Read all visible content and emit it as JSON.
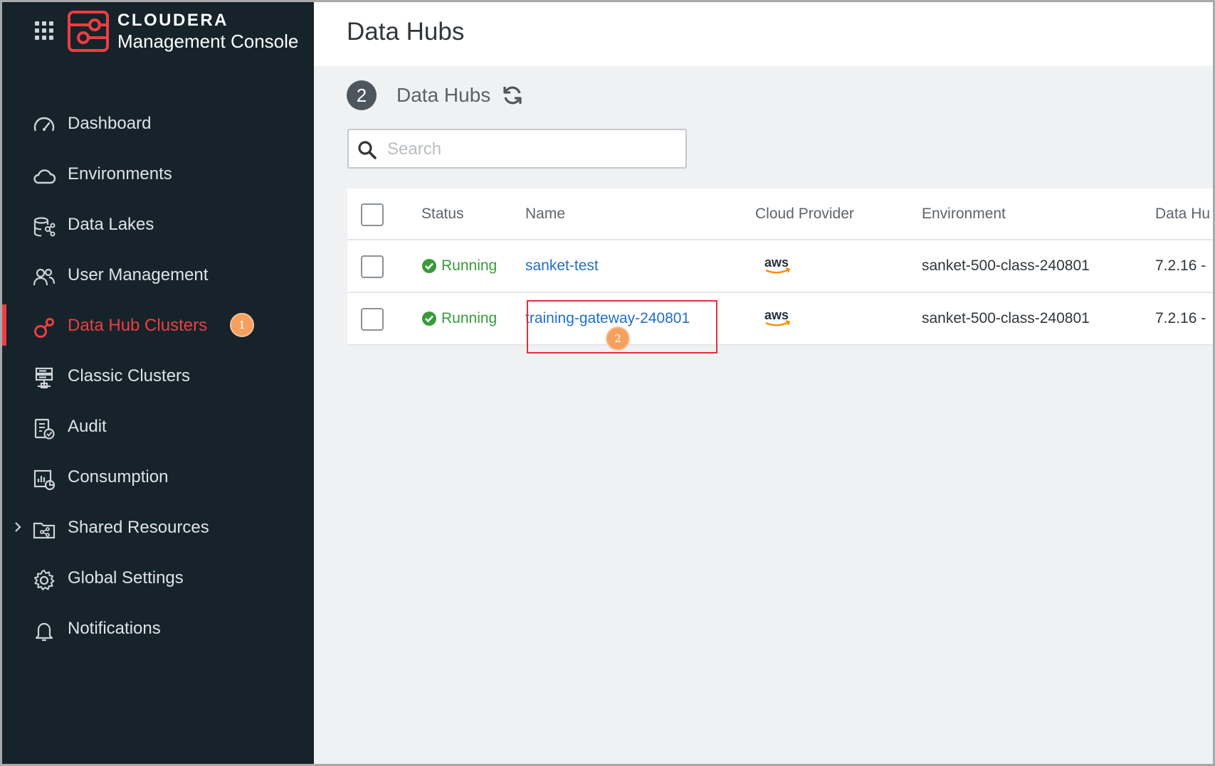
{
  "brand": {
    "name": "CLOUDERA",
    "subtitle": "Management Console",
    "accent": "#ef3e42"
  },
  "sidebar": {
    "items": [
      {
        "label": "Dashboard",
        "icon": "dashboard-gauge-icon"
      },
      {
        "label": "Environments",
        "icon": "cloud-icon"
      },
      {
        "label": "Data Lakes",
        "icon": "data-lake-icon"
      },
      {
        "label": "User Management",
        "icon": "users-icon"
      },
      {
        "label": "Data Hub Clusters",
        "icon": "data-hub-icon",
        "active": true,
        "badge": "1"
      },
      {
        "label": "Classic Clusters",
        "icon": "server-stack-icon"
      },
      {
        "label": "Audit",
        "icon": "audit-clipboard-icon"
      },
      {
        "label": "Consumption",
        "icon": "consumption-chart-icon"
      },
      {
        "label": "Shared Resources",
        "icon": "shared-folder-icon",
        "expandable": true
      },
      {
        "label": "Global Settings",
        "icon": "gear-icon"
      },
      {
        "label": "Notifications",
        "icon": "bell-icon"
      }
    ]
  },
  "header": {
    "title": "Data Hubs"
  },
  "section": {
    "count": "2",
    "title": "Data Hubs"
  },
  "search": {
    "placeholder": "Search",
    "value": ""
  },
  "table": {
    "columns": [
      "Status",
      "Name",
      "Cloud Provider",
      "Environment",
      "Data Hu"
    ],
    "rows": [
      {
        "status": "Running",
        "name": "sanket-test",
        "provider": "aws",
        "environment": "sanket-500-class-240801",
        "version": "7.2.16 -"
      },
      {
        "status": "Running",
        "name": "training-gateway-240801",
        "provider": "aws",
        "environment": "sanket-500-class-240801",
        "version": "7.2.16 -"
      }
    ]
  },
  "annotations": {
    "step1": "1",
    "step2": "2"
  }
}
